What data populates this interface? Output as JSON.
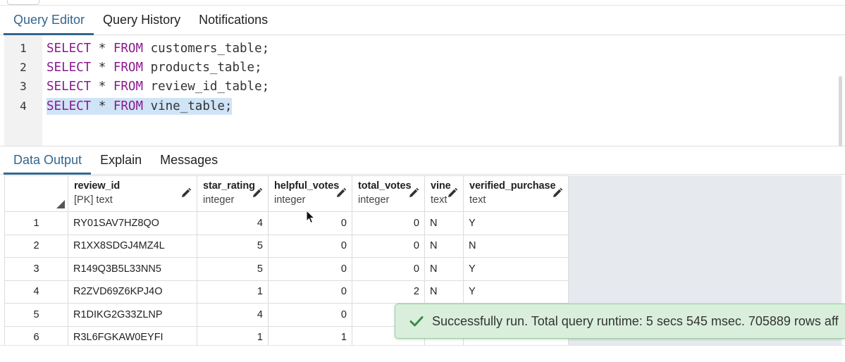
{
  "editor_tabs": [
    {
      "label": "Query Editor",
      "active": true
    },
    {
      "label": "Query History",
      "active": false
    },
    {
      "label": "Notifications",
      "active": false
    }
  ],
  "editor": {
    "lines": [
      {
        "num": "1",
        "keyword1": "SELECT",
        "op": "*",
        "keyword2": "FROM",
        "table": "customers_table;",
        "selected": false
      },
      {
        "num": "2",
        "keyword1": "SELECT",
        "op": "*",
        "keyword2": "FROM",
        "table": "products_table;",
        "selected": false
      },
      {
        "num": "3",
        "keyword1": "SELECT",
        "op": "*",
        "keyword2": "FROM",
        "table": "review_id_table;",
        "selected": false
      },
      {
        "num": "4",
        "keyword1": "SELECT",
        "op": "*",
        "keyword2": "FROM",
        "table": "vine_table;",
        "selected": true
      }
    ]
  },
  "output_tabs": [
    {
      "label": "Data Output",
      "active": true
    },
    {
      "label": "Explain",
      "active": false
    },
    {
      "label": "Messages",
      "active": false
    }
  ],
  "grid": {
    "columns": [
      {
        "name": "review_id",
        "type": "[PK] text"
      },
      {
        "name": "star_rating",
        "type": "integer"
      },
      {
        "name": "helpful_votes",
        "type": "integer"
      },
      {
        "name": "total_votes",
        "type": "integer"
      },
      {
        "name": "vine",
        "type": "text"
      },
      {
        "name": "verified_purchase",
        "type": "text"
      }
    ],
    "rows": [
      {
        "n": "1",
        "review_id": "RY01SAV7HZ8QO",
        "star_rating": "4",
        "helpful_votes": "0",
        "total_votes": "0",
        "vine": "N",
        "verified_purchase": "Y"
      },
      {
        "n": "2",
        "review_id": "R1XX8SDGJ4MZ4L",
        "star_rating": "5",
        "helpful_votes": "0",
        "total_votes": "0",
        "vine": "N",
        "verified_purchase": "N"
      },
      {
        "n": "3",
        "review_id": "R149Q3B5L33NN5",
        "star_rating": "5",
        "helpful_votes": "0",
        "total_votes": "0",
        "vine": "N",
        "verified_purchase": "Y"
      },
      {
        "n": "4",
        "review_id": "R2ZVD69Z6KPJ4O",
        "star_rating": "1",
        "helpful_votes": "0",
        "total_votes": "2",
        "vine": "N",
        "verified_purchase": "Y"
      },
      {
        "n": "5",
        "review_id": "R1DIKG2G33ZLNP",
        "star_rating": "4",
        "helpful_votes": "0",
        "total_votes": "",
        "vine": "",
        "verified_purchase": ""
      },
      {
        "n": "6",
        "review_id": "R3L6FGKAW0EYFI",
        "star_rating": "1",
        "helpful_votes": "1",
        "total_votes": "",
        "vine": "",
        "verified_purchase": ""
      }
    ]
  },
  "toast": {
    "message": "Successfully run. Total query runtime: 5 secs 545 msec. 705889 rows aff"
  },
  "colors": {
    "accent": "#326690",
    "keyword": "#8a1a8f",
    "selection": "#cfe4f6",
    "toast_bg": "#d9efdc",
    "toast_check": "#3d8b47"
  },
  "icons": {
    "edit": "pencil-icon",
    "success": "check-icon",
    "sort_corner": "corner-triangle-icon",
    "pointer": "mouse-cursor-icon"
  }
}
